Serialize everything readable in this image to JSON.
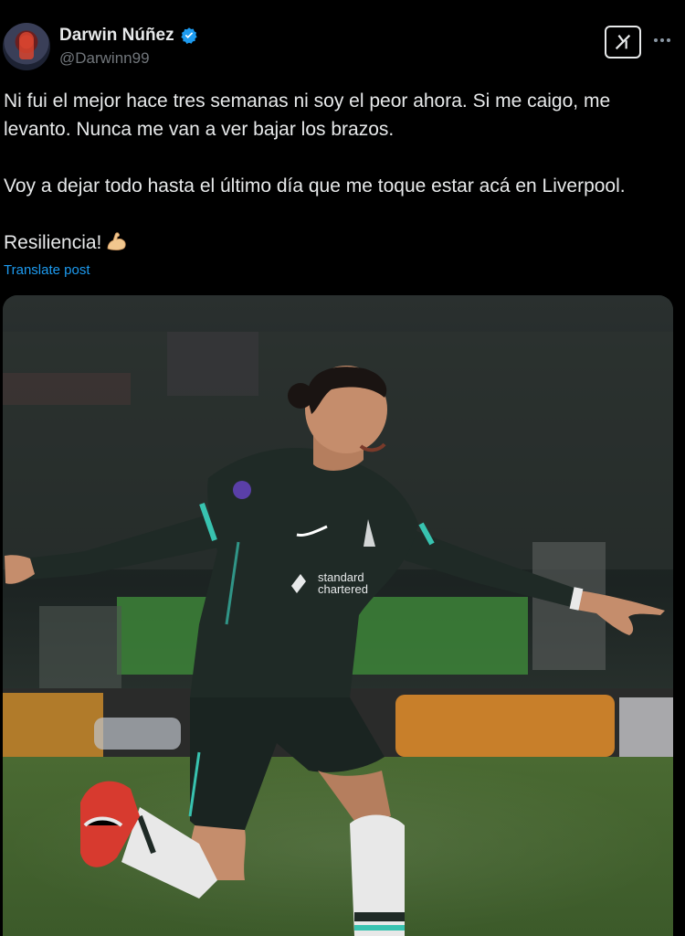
{
  "author": {
    "display_name": "Darwin Núñez",
    "handle": "@Darwinn99",
    "verified": true,
    "avatar_icon": "profile-avatar"
  },
  "post": {
    "paragraphs": [
      "Ni fui el mejor hace tres semanas ni soy el peor ahora. Si me caigo, me levanto. Nunca me van a ver bajar los brazos.",
      "Voy a dejar todo hasta el último día que me toque estar acá en Liverpool.",
      "Resiliencia!"
    ],
    "emoji": "flexed-biceps-icon",
    "translate_label": "Translate post"
  },
  "toolbar": {
    "grok_icon": "grok-icon",
    "more_icon": "more-options-icon"
  },
  "media": {
    "alt": "Liverpool player celebrating on the pitch",
    "shirt_sponsor": "standard chartered"
  },
  "colors": {
    "background": "#000000",
    "text": "#e7e9ea",
    "secondary": "#71767b",
    "link": "#1d9bf0",
    "verified": "#1d9bf0",
    "kit": "#1f2a26",
    "kit_accent": "#38c3b0"
  }
}
